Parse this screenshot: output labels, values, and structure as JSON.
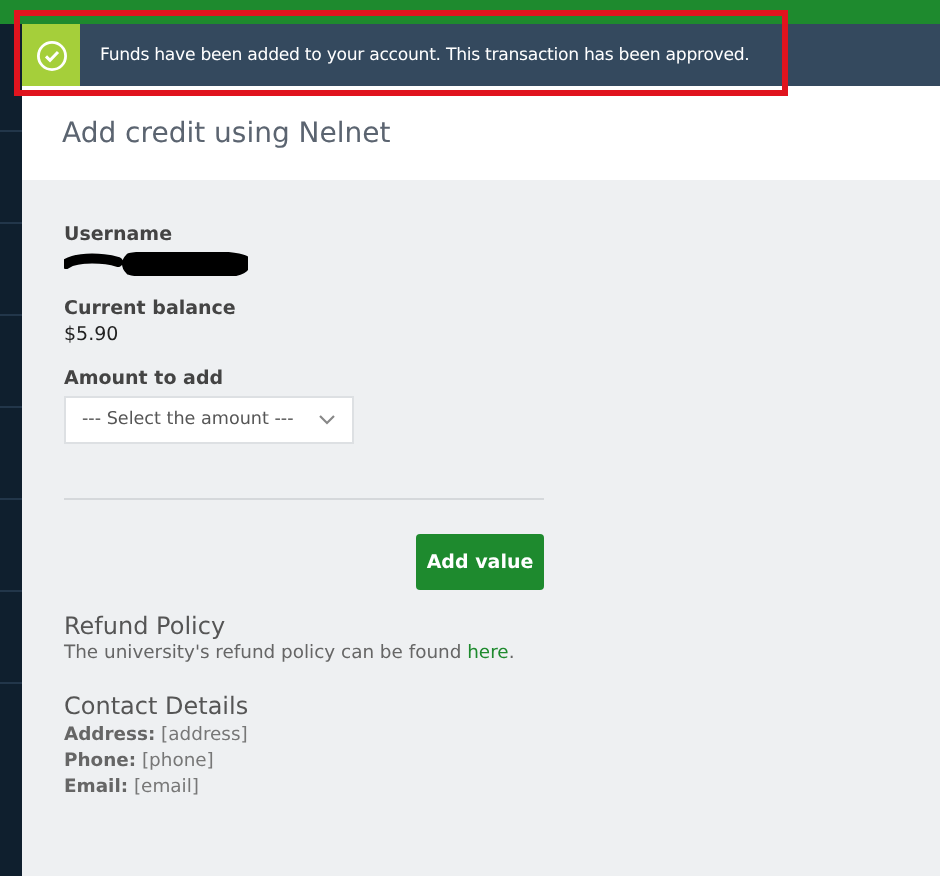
{
  "notification": {
    "message": "Funds have been added to your account. This transaction has been approved."
  },
  "header": {
    "title": "Add credit using Nelnet"
  },
  "form": {
    "username_label": "Username",
    "balance_label": "Current balance",
    "balance": "$5.90",
    "amount_label": "Amount to add",
    "amount_placeholder": "--- Select the amount ---",
    "submit": "Add value"
  },
  "refund": {
    "heading": "Refund Policy",
    "text": "The university's refund policy can be found ",
    "link": "here",
    "after": "."
  },
  "contact": {
    "heading": "Contact Details",
    "lines": [
      "**Address:** [address]",
      "**Phone:** [phone]",
      "**Email:** [email]"
    ]
  }
}
